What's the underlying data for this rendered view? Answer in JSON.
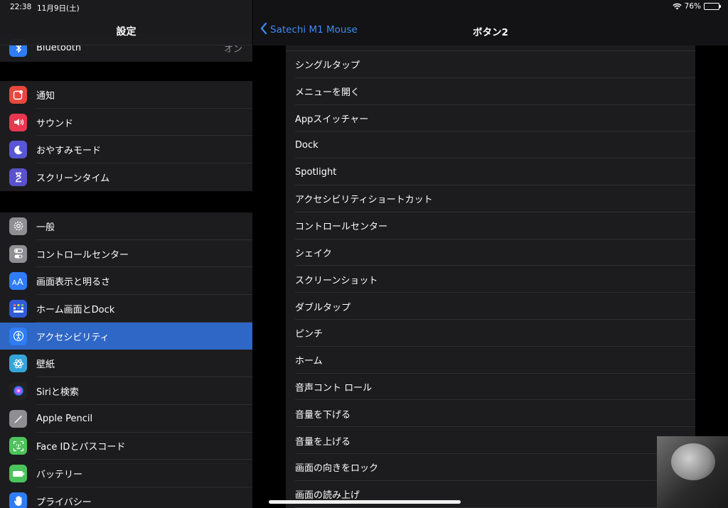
{
  "status_bar": {
    "time": "22:38",
    "date": "11月9日(土)",
    "battery": "76%",
    "battery_level": 0.76
  },
  "sidebar": {
    "title": "設定",
    "partial_item": {
      "label": "Bluetooth",
      "value": "オン"
    },
    "group2": [
      {
        "label": "通知",
        "icon": "notifications-icon",
        "color": "#e9473c"
      },
      {
        "label": "サウンド",
        "icon": "sound-icon",
        "color": "#e8374f"
      },
      {
        "label": "おやすみモード",
        "icon": "moon-icon",
        "color": "#5856d6"
      },
      {
        "label": "スクリーンタイム",
        "icon": "hourglass-icon",
        "color": "#5a52cc"
      }
    ],
    "group3": [
      {
        "label": "一般",
        "icon": "gear-icon",
        "color": "#8e8e93"
      },
      {
        "label": "コントロールセンター",
        "icon": "toggles-icon",
        "color": "#8e8e93"
      },
      {
        "label": "画面表示と明るさ",
        "icon": "text-size-icon",
        "color": "#2f7cf6"
      },
      {
        "label": "ホーム画面とDock",
        "icon": "home-grid-icon",
        "color": "#2f5bd6"
      },
      {
        "label": "アクセシビリティ",
        "icon": "accessibility-icon",
        "color": "#2f7cf6"
      },
      {
        "label": "壁紙",
        "icon": "wallpaper-icon",
        "color": "#35a5d9"
      },
      {
        "label": "Siriと検索",
        "icon": "siri-icon",
        "color": "#222"
      },
      {
        "label": "Apple Pencil",
        "icon": "pencil-icon",
        "color": "#8e8e93"
      },
      {
        "label": "Face IDとパスコード",
        "icon": "face-id-icon",
        "color": "#4cc35b"
      },
      {
        "label": "バッテリー",
        "icon": "battery-icon",
        "color": "#4cc35b"
      },
      {
        "label": "プライバシー",
        "icon": "hand-icon",
        "color": "#2f7cf6"
      }
    ],
    "selected_label": "アクセシビリティ"
  },
  "detail": {
    "back_label": "Satechi M1 Mouse",
    "title": "ボタン2",
    "options": [
      "シングルタップ",
      "メニューを開く",
      "Appスイッチャー",
      "Dock",
      "Spotlight",
      "アクセシビリティショートカット",
      "コントロールセンター",
      "シェイク",
      "スクリーンショット",
      "ダブルタップ",
      "ピンチ",
      "ホーム",
      "音声コント ロール",
      "音量を下げる",
      "音量を上げる",
      "画面の向きをロック",
      "画面の読み上げ"
    ]
  }
}
